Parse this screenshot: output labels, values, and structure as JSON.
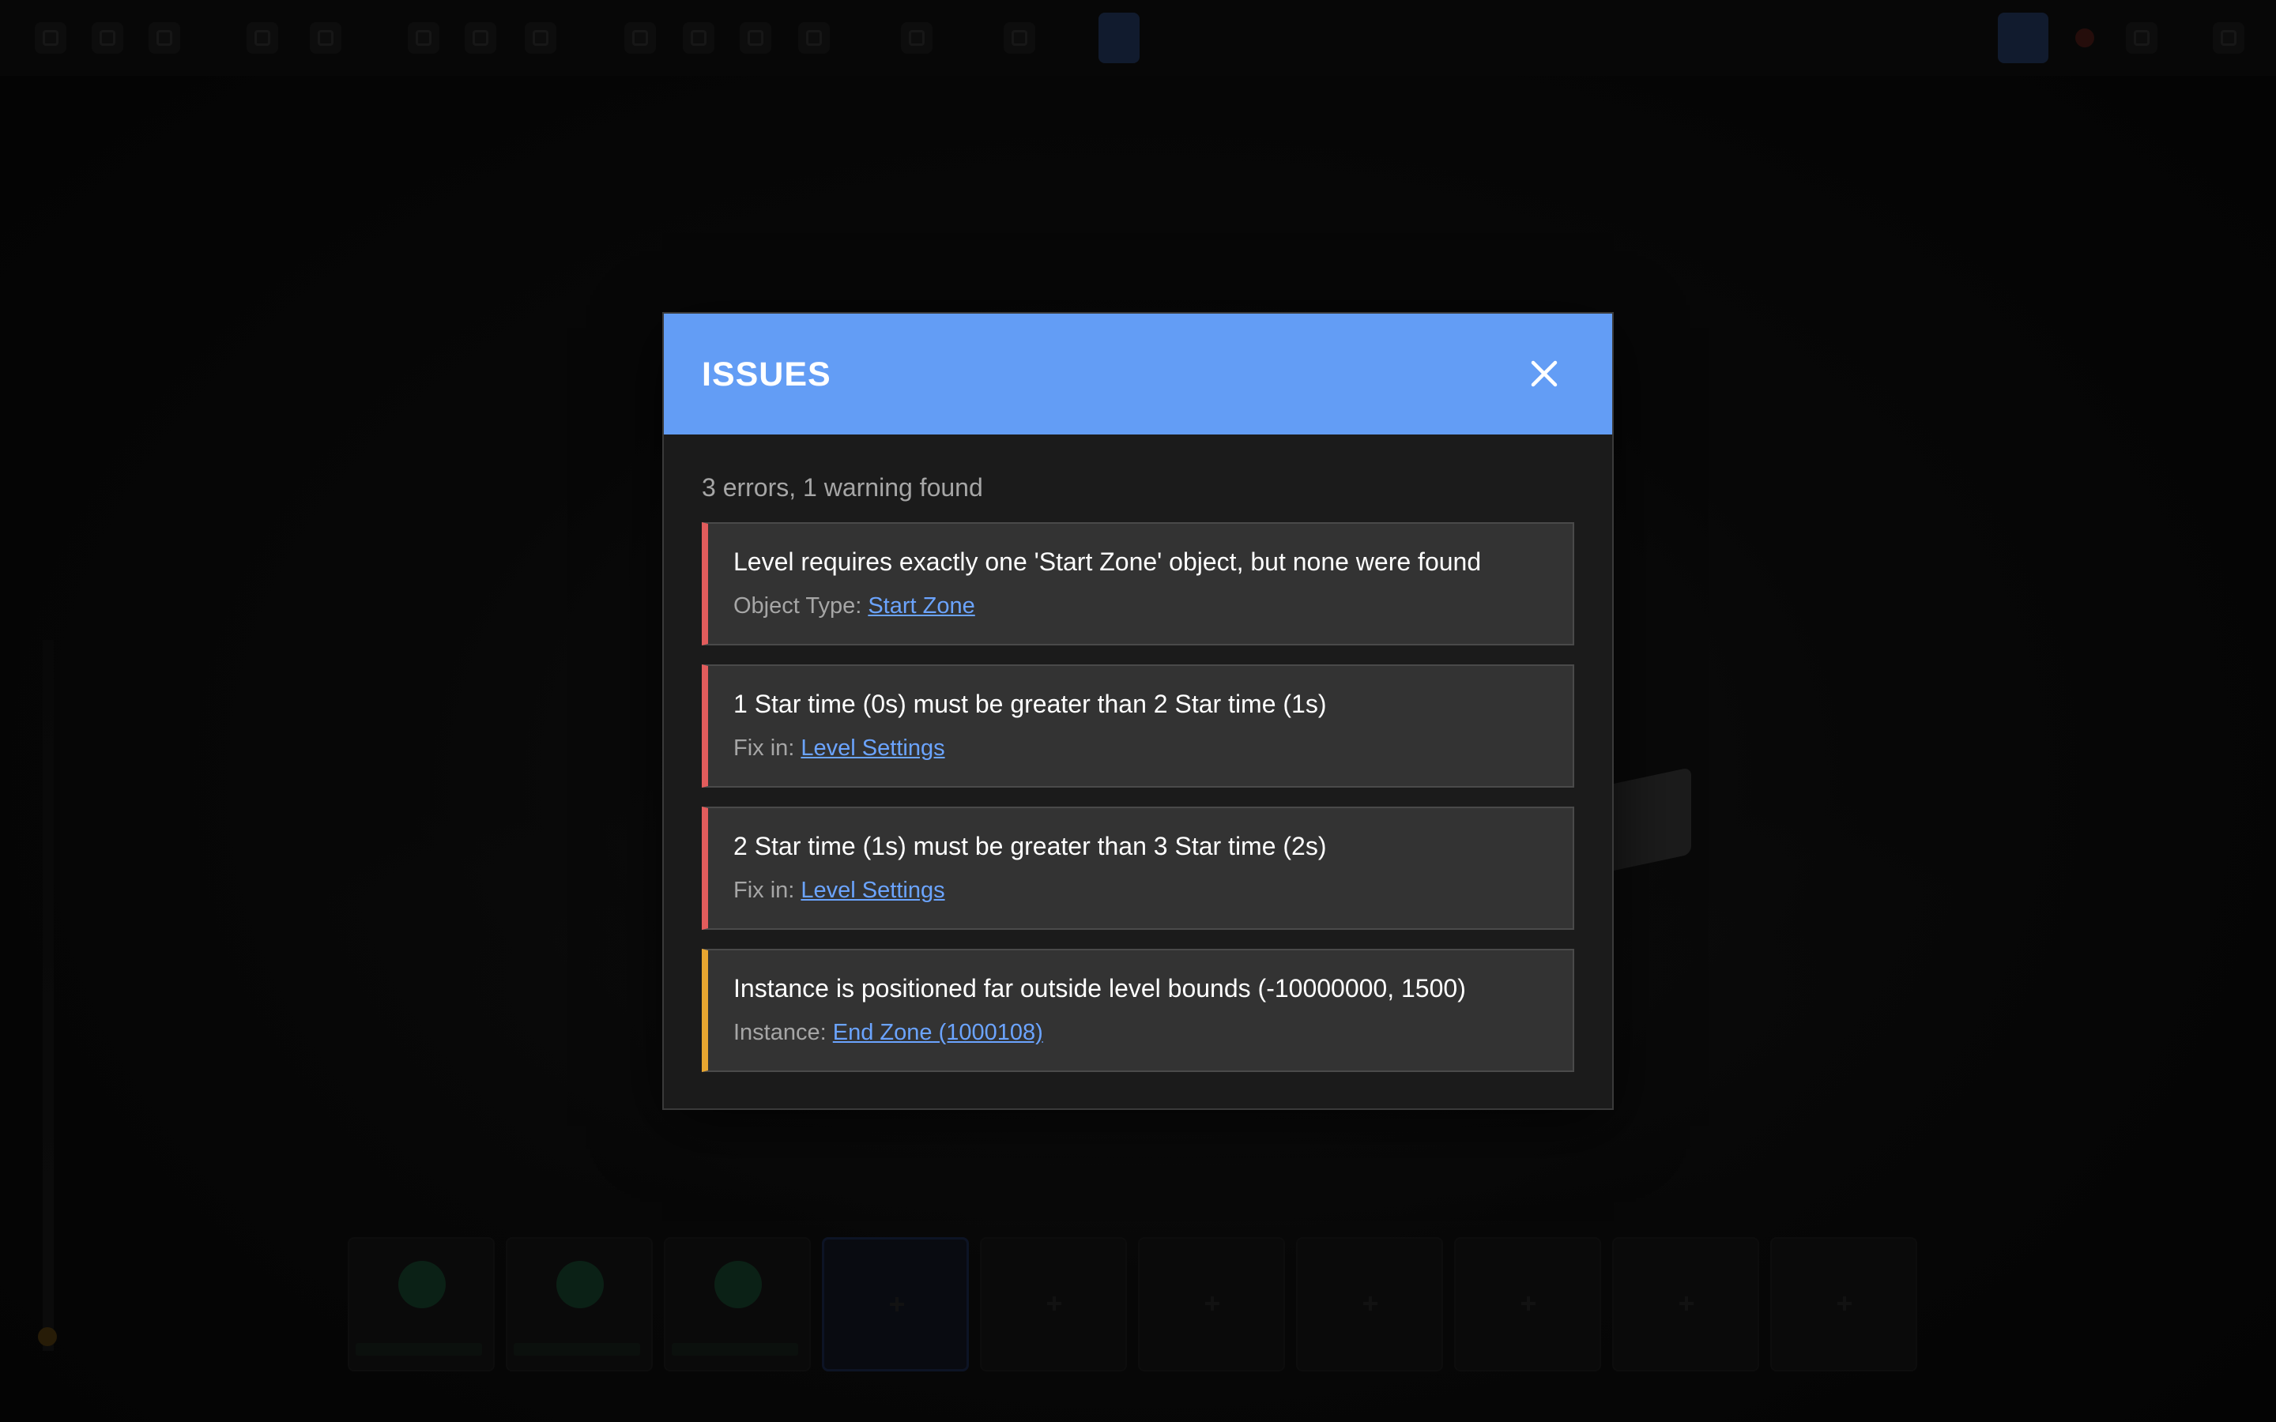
{
  "colors": {
    "header_bg": "#639df5",
    "modal_bg": "#1b1b1b",
    "card_bg": "#333333",
    "error_accent": "#e25c5c",
    "warning_accent": "#e8a630",
    "link": "#6ba4ff"
  },
  "toolbar": {
    "icons": [
      "file-icon",
      "copy-icon",
      "save-icon",
      "undo-icon",
      "redo-icon",
      "cut-icon",
      "paste-icon",
      "delete-icon",
      "move-icon",
      "rotate-icon",
      "scale-icon",
      "snap-icon",
      "grid-icon",
      "camera-icon",
      "select-icon",
      "view-icon",
      "record-icon",
      "play-icon",
      "settings-icon"
    ]
  },
  "dialog": {
    "title": "ISSUES",
    "close_icon": "close-icon",
    "summary": "3 errors, 1 warning found",
    "issues": [
      {
        "severity": "error",
        "message": "Level requires exactly one 'Start Zone' object, but none were found",
        "detail_label": "Object Type: ",
        "link_text": "Start Zone"
      },
      {
        "severity": "error",
        "message": "1 Star time (0s) must be greater than 2 Star time (1s)",
        "detail_label": "Fix in: ",
        "link_text": "Level Settings"
      },
      {
        "severity": "error",
        "message": "2 Star time (1s) must be greater than 3 Star time (2s)",
        "detail_label": "Fix in: ",
        "link_text": "Level Settings"
      },
      {
        "severity": "warning",
        "message": "Instance is positioned far outside level bounds (-10000000, 1500)",
        "detail_label": "Instance: ",
        "link_text": "End Zone (1000108)"
      }
    ]
  }
}
